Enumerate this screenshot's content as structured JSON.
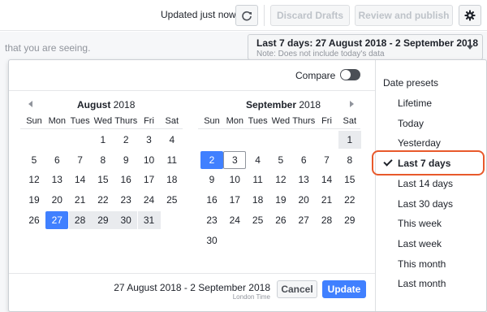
{
  "toolbar": {
    "updated_text": "Updated just now",
    "discard_label": "Discard Drafts",
    "review_label": "Review and publish",
    "refresh_icon": "refresh-icon",
    "gear_icon": "gear-icon"
  },
  "background": {
    "hint_text": "that you are seeing.",
    "range_button": {
      "label": "Last 7 days: 27 August 2018 - 2 September 2018",
      "note": "Note: Does not include today's data"
    }
  },
  "popover": {
    "compare_label": "Compare",
    "compare_on": false,
    "weekdays": [
      "Sun",
      "Mon",
      "Tues",
      "Wed",
      "Thurs",
      "Fri",
      "Sat"
    ],
    "calendars": [
      {
        "month": "August",
        "year": "2018",
        "weeks": [
          [
            "",
            "",
            "",
            "1",
            "2",
            "3",
            "4"
          ],
          [
            "5",
            "6",
            "7",
            "8",
            "9",
            "10",
            "11"
          ],
          [
            "12",
            "13",
            "14",
            "15",
            "16",
            "17",
            "18"
          ],
          [
            "19",
            "20",
            "21",
            "22",
            "23",
            "24",
            "25"
          ],
          [
            "26",
            "27",
            "28",
            "29",
            "30",
            "31",
            ""
          ]
        ]
      },
      {
        "month": "September",
        "year": "2018",
        "weeks": [
          [
            "",
            "",
            "",
            "",
            "",
            "",
            "1"
          ],
          [
            "2",
            "3",
            "4",
            "5",
            "6",
            "7",
            "8"
          ],
          [
            "9",
            "10",
            "11",
            "12",
            "13",
            "14",
            "15"
          ],
          [
            "16",
            "17",
            "18",
            "19",
            "20",
            "21",
            "22"
          ],
          [
            "23",
            "24",
            "25",
            "26",
            "27",
            "28",
            "29"
          ],
          [
            "30",
            "",
            "",
            "",
            "",
            "",
            ""
          ]
        ]
      }
    ],
    "selected_range": "27 August 2018 - 2 September 2018",
    "timezone": "London Time",
    "cancel_label": "Cancel",
    "update_label": "Update"
  },
  "presets": {
    "title": "Date presets",
    "items": [
      "Lifetime",
      "Today",
      "Yesterday",
      "Last 7 days",
      "Last 14 days",
      "Last 30 days",
      "This week",
      "Last week",
      "This month",
      "Last month"
    ],
    "selected": "Last 7 days"
  },
  "colors": {
    "accent": "#4080ff",
    "range_fill": "#e9ebee",
    "highlight": "#e8592b"
  }
}
